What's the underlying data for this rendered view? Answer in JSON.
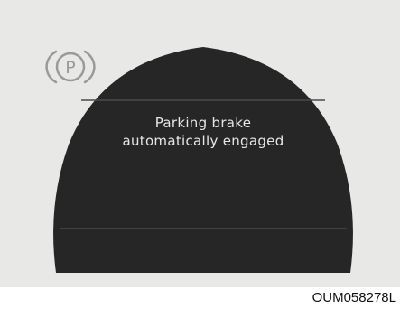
{
  "colors": {
    "background": "#e8e8e7",
    "display_body": "#262626",
    "divider": "#4a4a4a",
    "text": "#e6e6e6",
    "icon": "#9a9a9a"
  },
  "display": {
    "message_line1": "Parking brake",
    "message_line2": "automatically engaged",
    "icon": "parking-brake-icon",
    "icon_letter": "P"
  },
  "caption": "OUM058278L"
}
